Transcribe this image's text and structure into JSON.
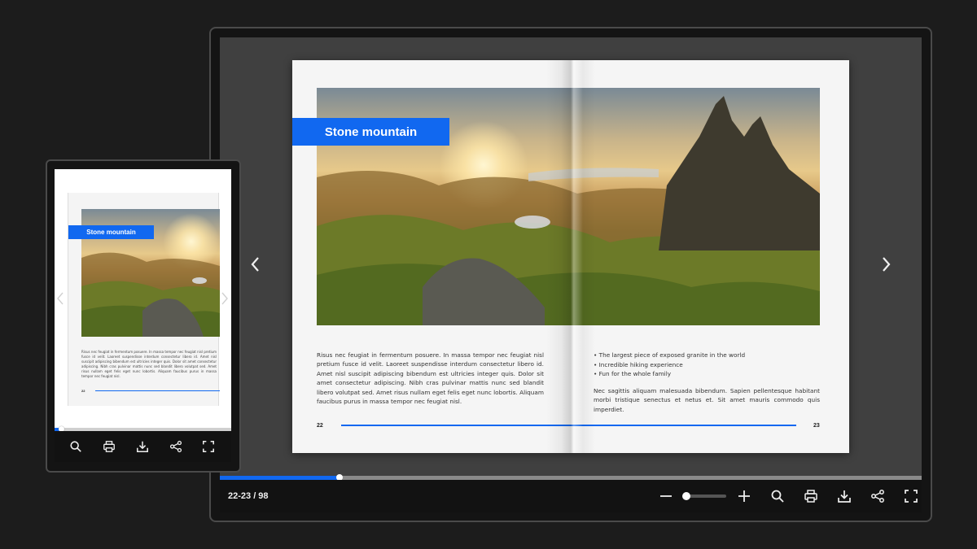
{
  "viewer": {
    "page_counter": "22-23 / 98",
    "reading_progress": 0.171,
    "zoom_level": 0.06,
    "accent_color": "#1168f0",
    "prev_icon": "chevron-left-icon",
    "next_icon": "chevron-right-icon"
  },
  "toolbar": {
    "buttons": [
      "zoom-out-icon",
      "zoom-slider",
      "zoom-in-icon",
      "search-icon",
      "print-icon",
      "download-icon",
      "share-icon",
      "fullscreen-icon"
    ]
  },
  "spread": {
    "title": "Stone mountain",
    "left_paragraph": "Risus nec feugiat in fermentum posuere. In massa tempor nec feugiat nisl pretium fusce id velit. Laoreet suspendisse interdum consectetur libero id. Amet nisl suscipit adipiscing bibendum est ultricies integer quis. Dolor sit amet consectetur adipiscing. Nibh cras pulvinar mattis nunc sed blandit libero volutpat sed. Amet risus nullam eget felis eget nunc lobortis. Aliquam faucibus purus in massa tempor nec feugiat nisl.",
    "bullets": [
      "The largest piece of exposed granite in the world",
      "Incredible hiking experience",
      "Fun for the whole family"
    ],
    "right_paragraph": "Nec sagittis aliquam malesuada bibendum. Sapien pellentesque habitant morbi tristique senectus et netus et. Sit amet mauris commodo quis imperdiet.",
    "page_left": "22",
    "page_right": "23"
  },
  "tablet": {
    "title": "Stone mountain",
    "paragraph": "Risus nec feugiat in fermentum posuere. In massa tempor nec feugiat nisl pretium fusce id velit. Laoreet suspendisse interdum consectetur libero id. Amet nisl suscipit adipiscing bibendum est ultricies integer quis. Dolor sit amet consectetur adipiscing. Nibh cras pulvinar mattis nunc sed blandit libero volutpat sed. Amet risus nullam eget felis eget nunc lobortis. Aliquam faucibus purus in massa tempor nec feugiat nisl.",
    "page_num": "22",
    "reading_progress": 0.035,
    "buttons": [
      "search-icon",
      "print-icon",
      "download-icon",
      "share-icon",
      "fullscreen-icon"
    ]
  }
}
